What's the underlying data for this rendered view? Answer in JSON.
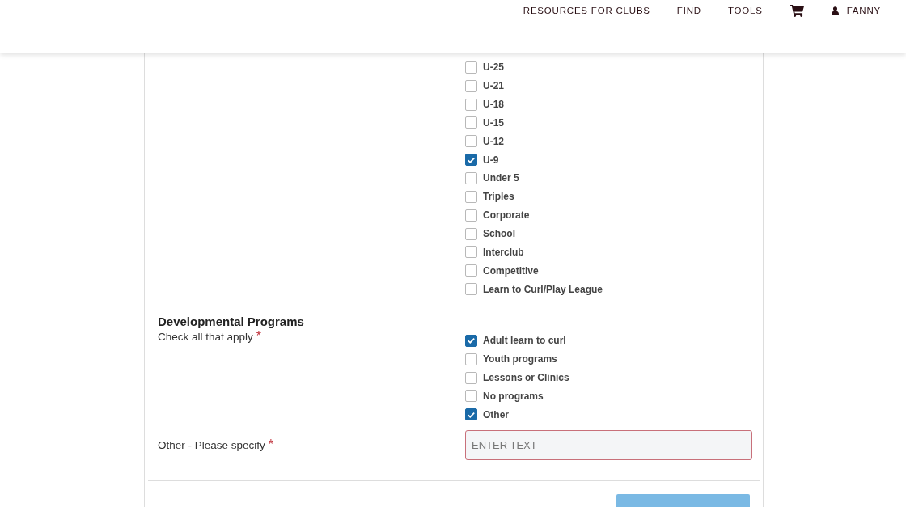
{
  "nav": {
    "links": [
      "RESOURCES FOR CLUBS",
      "FIND",
      "TOOLS"
    ],
    "user": "FANNY"
  },
  "age_groups": [
    {
      "label": "U-25",
      "checked": false
    },
    {
      "label": "U-21",
      "checked": false
    },
    {
      "label": "U-18",
      "checked": false
    },
    {
      "label": "U-15",
      "checked": false
    },
    {
      "label": "U-12",
      "checked": false
    },
    {
      "label": "U-9",
      "checked": true
    },
    {
      "label": "Under 5",
      "checked": false
    },
    {
      "label": "Triples",
      "checked": false
    },
    {
      "label": "Corporate",
      "checked": false
    },
    {
      "label": "School",
      "checked": false
    },
    {
      "label": "Interclub",
      "checked": false
    },
    {
      "label": "Competitive",
      "checked": false
    },
    {
      "label": "Learn to Curl/Play League",
      "checked": false
    }
  ],
  "developmental_programs": {
    "title": "Developmental Programs",
    "prompt": "Check all that apply",
    "required_mark": "*",
    "options": [
      {
        "label": "Adult learn to curl",
        "checked": true
      },
      {
        "label": "Youth programs",
        "checked": false
      },
      {
        "label": "Lessons or Clinics",
        "checked": false
      },
      {
        "label": "No programs",
        "checked": false
      },
      {
        "label": "Other",
        "checked": true
      }
    ]
  },
  "other_field": {
    "label": "Other - Please specify",
    "required_mark": "*",
    "placeholder": "ENTER TEXT",
    "invalid": true
  }
}
